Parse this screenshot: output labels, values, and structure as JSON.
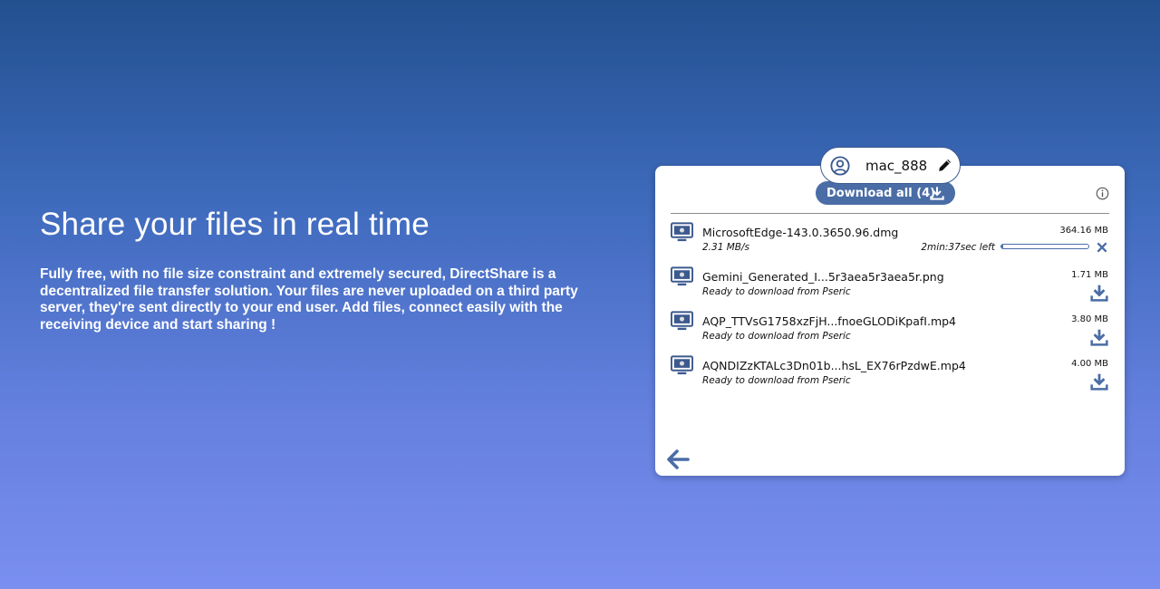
{
  "hero": {
    "title": "Share your files in real time",
    "description": "Fully free, with no file size constraint and extremely secured, DirectShare is a decentralized file transfer solution. Your files are never uploaded on a third party server, they're sent directly to your end user. Add files, connect easily with the receiving device and start sharing !"
  },
  "panel": {
    "username": "mac_888",
    "download_all_label": "Download all (4)",
    "files": [
      {
        "name": "MicrosoftEdge-143.0.3650.96.dmg",
        "size": "364.16 MB",
        "speed": "2.31 MB/s",
        "eta": "2min:37sec left",
        "progress": 0.02,
        "state": "downloading"
      },
      {
        "name": "Gemini_Generated_I...5r3aea5r3aea5r.png",
        "size": "1.71 MB",
        "status": "Ready to download from Pseric",
        "state": "ready"
      },
      {
        "name": "AQP_TTVsG1758xzFjH...fnoeGLODiKpafI.mp4",
        "size": "3.80 MB",
        "status": "Ready to download from Pseric",
        "state": "ready"
      },
      {
        "name": "AQNDIZzKTALc3Dn01b...hsL_EX76rPzdwE.mp4",
        "size": "4.00 MB",
        "status": "Ready to download from Pseric",
        "state": "ready"
      }
    ]
  },
  "colors": {
    "accent": "#4a6da6",
    "icon": "#3c5a8e"
  },
  "icons": {
    "avatar": "user-circle-icon",
    "edit": "pencil-icon",
    "info": "info-icon",
    "monitor": "monitor-icon",
    "download": "download-icon",
    "cancel": "close-icon",
    "back": "arrow-left-icon"
  }
}
